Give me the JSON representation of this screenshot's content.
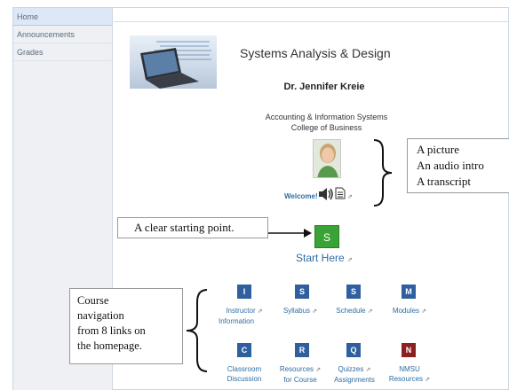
{
  "sidebar": {
    "items": [
      {
        "label": "Home"
      },
      {
        "label": "Announcements"
      },
      {
        "label": "Grades"
      }
    ]
  },
  "header": {
    "title": "Systems Analysis & Design"
  },
  "instructor": {
    "name": "Dr. Jennifer Kreie",
    "dept_line1": "Accounting & Information Systems",
    "dept_line2": "College of Business",
    "welcome_label": "Welcome!"
  },
  "callouts": {
    "pic": [
      "A picture",
      "An audio intro",
      "A transcript"
    ],
    "start": "A clear starting point.",
    "nav": [
      "Course",
      "navigation",
      "from 8 links on",
      "the homepage."
    ]
  },
  "start": {
    "button_letter": "S",
    "label": "Start Here"
  },
  "nav_tiles": [
    {
      "letter": "I",
      "label1": "Instructor",
      "label2": "Information"
    },
    {
      "letter": "S",
      "label1": "Syllabus",
      "label2": ""
    },
    {
      "letter": "S",
      "label1": "Schedule",
      "label2": ""
    },
    {
      "letter": "M",
      "label1": "Modules",
      "label2": ""
    },
    {
      "letter": "C",
      "label1": "Classroom",
      "label2": "Discussion"
    },
    {
      "letter": "R",
      "label1": "Resources",
      "label2": "for Course"
    },
    {
      "letter": "Q",
      "label1": "Quizzes",
      "label2": "Assignments"
    },
    {
      "letter": "N",
      "label1": "NMSU",
      "label2": "Resources"
    }
  ],
  "icons": {
    "external": "external-link-icon",
    "speaker": "speaker-icon",
    "document": "document-icon"
  },
  "colors": {
    "tile_blue": "#2f5f9e",
    "tile_red": "#8c2020",
    "start_green": "#3aa335",
    "link_blue": "#2e6da4"
  }
}
